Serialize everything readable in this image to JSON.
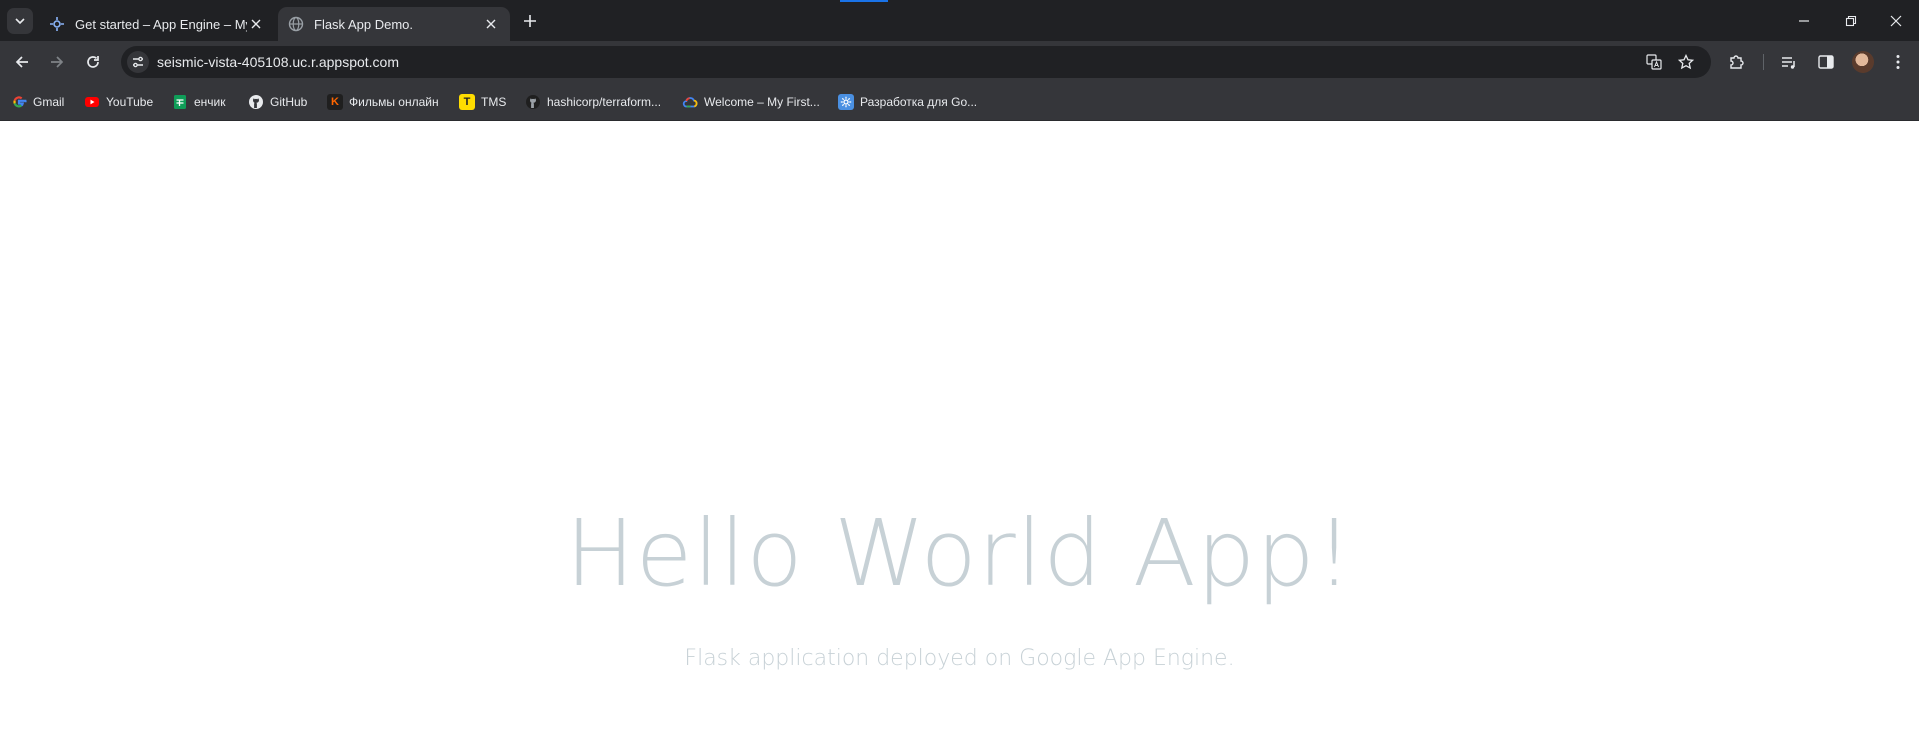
{
  "browser": {
    "tabs": [
      {
        "title": "Get started – App Engine – My",
        "favicon": "app-engine-icon",
        "active": false
      },
      {
        "title": "Flask App Demo.",
        "favicon": "globe-icon",
        "active": true
      }
    ],
    "address_bar": {
      "url": "seismic-vista-405108.uc.r.appspot.com"
    },
    "bookmarks": [
      {
        "label": "Gmail",
        "icon": "google-icon",
        "color": "#4285f4"
      },
      {
        "label": "YouTube",
        "icon": "youtube-icon",
        "color": "#ff0000"
      },
      {
        "label": "енчик",
        "icon": "sheets-icon",
        "color": "#0f9d58"
      },
      {
        "label": "GitHub",
        "icon": "github-icon",
        "color": "#ffffff"
      },
      {
        "label": "Фильмы онлайн",
        "icon": "kinopoisk-icon",
        "color": "#ff6600",
        "glyph": "K"
      },
      {
        "label": "TMS",
        "icon": "tms-icon",
        "color": "#ffdd00",
        "glyph": "T"
      },
      {
        "label": "hashicorp/terraform...",
        "icon": "github-icon",
        "color": "#ffffff"
      },
      {
        "label": "Welcome – My First...",
        "icon": "google-cloud-icon",
        "color": "#4285f4"
      },
      {
        "label": "Разработка для Go...",
        "icon": "gear-icon",
        "color": "#4a90e2"
      }
    ]
  },
  "page": {
    "title": "Hello World App!",
    "subtitle": "Flask application deployed on Google App Engine."
  }
}
